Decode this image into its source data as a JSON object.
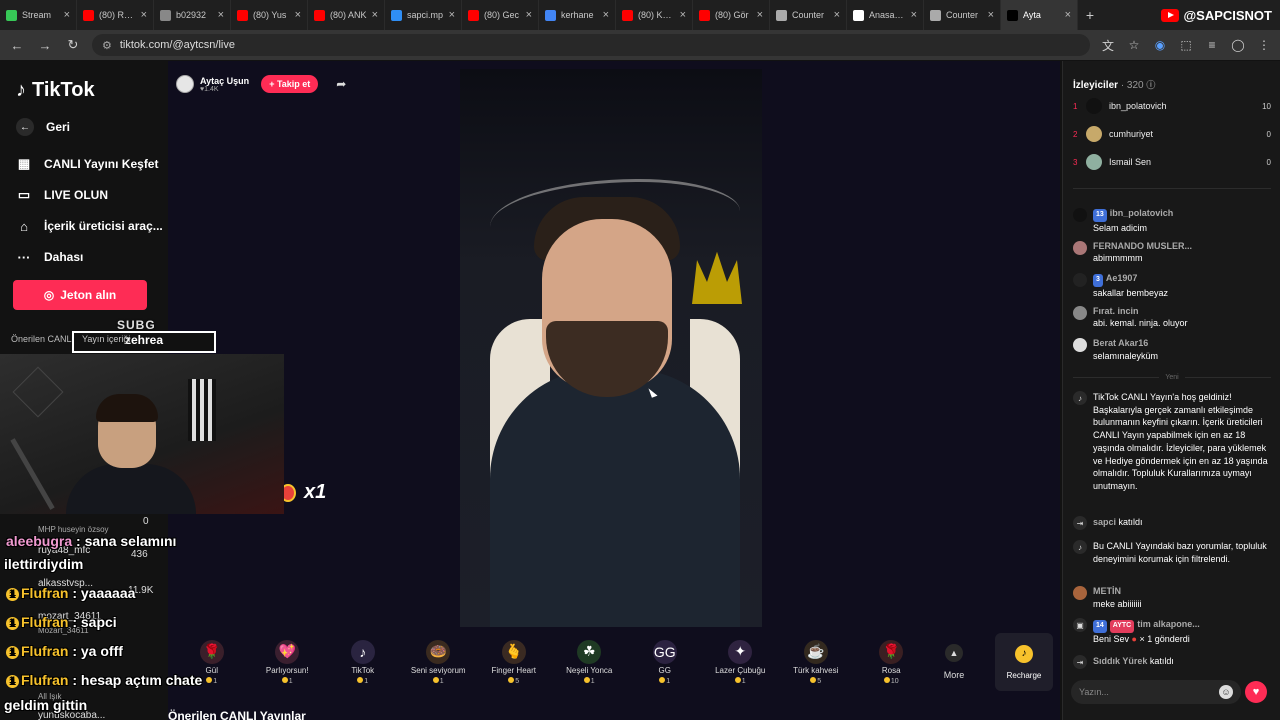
{
  "browser": {
    "tabs": [
      {
        "label": "Stream",
        "color": "#37c857",
        "active": false
      },
      {
        "label": "(80) Real",
        "color": "#ff0000",
        "active": false
      },
      {
        "label": "b02932",
        "color": "#888888",
        "active": false
      },
      {
        "label": "(80) Yus",
        "color": "#ff0000",
        "active": false
      },
      {
        "label": "(80) ANK",
        "color": "#ff0000",
        "active": false
      },
      {
        "label": "sapci.mp",
        "color": "#2f8ef5",
        "active": false
      },
      {
        "label": "(80) Gec",
        "color": "#ff0000",
        "active": false
      },
      {
        "label": "kerhane",
        "color": "#4285f4",
        "active": false
      },
      {
        "label": "(80) KAR",
        "color": "#ff0000",
        "active": false
      },
      {
        "label": "(80) Gör",
        "color": "#ff0000",
        "active": false
      },
      {
        "label": "Counter",
        "color": "#aaaaaa",
        "active": false
      },
      {
        "label": "Anasayfa",
        "color": "#ffffff",
        "active": false
      },
      {
        "label": "Counter",
        "color": "#aaaaaa",
        "active": false
      },
      {
        "label": "Ayta",
        "color": "#000000",
        "active": true
      }
    ],
    "url": "tiktok.com/@aytcsn/live",
    "channel_brand": "@SAPCISNOT"
  },
  "nav": {
    "logo_text": "TikTok",
    "back": "Geri",
    "explore": "CANLI Yayını Keşfet",
    "go_live": "LIVE OLUN",
    "creator_tools": "İçerik üreticisi araç...",
    "more": "Dahası",
    "jeton_button": "Jeton alın",
    "onerilen_partial": "Önerilen CANL"
  },
  "overlay": {
    "subg_tag": "SUBG",
    "subg_name": "zehrea",
    "onerilen_yayin": "Yayın içeriği",
    "gift_multiplier": "x1",
    "chat": [
      {
        "user": "aleebugra",
        "text": ": sana selamını",
        "gold": false
      },
      {
        "user": "",
        "text": "ilettirdiydim",
        "gold": false
      },
      {
        "user": "Flufran",
        "text": ": yaaaaaa",
        "gold": true
      },
      {
        "user": "Flufran",
        "text": ": sapci",
        "gold": true
      },
      {
        "user": "Flufran",
        "text": ": ya offf",
        "gold": true
      },
      {
        "user": "Flufran",
        "text": ": hesap açtım chate",
        "gold": true
      },
      {
        "user": "",
        "text": "geldim gittin",
        "gold": false
      }
    ],
    "under_texts": {
      "u1": "MHP huseyin özsoy",
      "u2": "ruya48_mfc",
      "u2v": "436",
      "u3": "alkasstvsp...",
      "u3v": "11.9K",
      "u4": "mozart_34611",
      "u5": "Mozart_34611",
      "u6": "All Işık",
      "u7": "yunuskocaba...",
      "zero": "0"
    }
  },
  "stage": {
    "streamer_name": "Aytaç Uşun",
    "streamer_likes": "♥1.4K",
    "follow_button": "+ Takip et",
    "gifts": [
      {
        "name": "Gül",
        "price": "1",
        "icon": "🌹",
        "bg": "#3a1f2a"
      },
      {
        "name": "Parlıyorsun!",
        "price": "1",
        "icon": "💖",
        "bg": "#3a1f2f"
      },
      {
        "name": "TikTok",
        "price": "1",
        "icon": "♪",
        "bg": "#2a2440"
      },
      {
        "name": "Seni seviyorum",
        "price": "1",
        "icon": "🍩",
        "bg": "#3a2a1f"
      },
      {
        "name": "Finger Heart",
        "price": "5",
        "icon": "🫰",
        "bg": "#3a2a22"
      },
      {
        "name": "Neşeli Yonca",
        "price": "1",
        "icon": "☘",
        "bg": "#1f3a24"
      },
      {
        "name": "GG",
        "price": "1",
        "icon": "GG",
        "bg": "#2b2240"
      },
      {
        "name": "Lazer Çubuğu",
        "price": "1",
        "icon": "✦",
        "bg": "#2f2340"
      },
      {
        "name": "Türk kahvesi",
        "price": "5",
        "icon": "☕",
        "bg": "#33291f"
      },
      {
        "name": "Rosa",
        "price": "10",
        "icon": "🌹",
        "bg": "#3a1f22"
      }
    ],
    "more_label": "More",
    "recharge_label": "Recharge",
    "onerilen_title": "Önerilen CANLI Yayınlar"
  },
  "right": {
    "viewers_title": "İzleyiciler",
    "viewers_count": "· 320",
    "viewers": [
      {
        "rank": "1",
        "name": "ibn_polatovich",
        "score": "10",
        "color": "#111111"
      },
      {
        "rank": "2",
        "name": "cumhuriyet",
        "score": "0",
        "color": "#c7a96a"
      },
      {
        "rank": "3",
        "name": "Ismail Sen",
        "score": "0",
        "color": "#8fb0a0"
      }
    ],
    "new_label": "Yeni",
    "messages": [
      {
        "user": "ibn_polatovich",
        "level": "13",
        "text": "Selam adicim",
        "av": "#111111"
      },
      {
        "user": "FERNANDO MUSLER...",
        "level": "",
        "text": "abimmmmm",
        "av": "#aa7777"
      },
      {
        "user": "Ae1907",
        "level": "3",
        "text": "sakallar bembeyaz",
        "av": "#222222"
      },
      {
        "user": "Fırat. incin",
        "level": "",
        "text": "abi. kemal. ninja. oluyor",
        "av": "#888888"
      },
      {
        "user": "Berat Akar16",
        "level": "",
        "text": "selamınaleyküm",
        "av": "#dddddd"
      }
    ],
    "welcome_text": "TikTok CANLI Yayın'a hoş geldiniz! Başkalarıyla gerçek zamanlı etkileşimde bulunmanın keyfini çıkarın. İçerik üreticileri CANLI Yayın yapabilmek için en az 18 yaşında olmalıdır. İzleyiciler, para yüklemek ve Hediye göndermek için en az 18 yaşında olmalıdır. Topluluk Kurallarımıza uymayı unutmayın.",
    "joined1_user": "sapci",
    "joined_label": "katıldı",
    "moderation_text": "Bu CANLI Yayındaki bazı yorumlar, topluluk deneyimini korumak için filtrelendi.",
    "metin_user": "METİN",
    "metin_text": "meke abiiiiiii",
    "gift_user": "tim alkapone...",
    "gift_level": "14",
    "gift_badge": "AYTC",
    "gift_text": "Beni Sev",
    "gift_sent": "× 1 gönderdi",
    "joined2_user": "Sıddık Yürek",
    "input_placeholder": "Yazın..."
  }
}
